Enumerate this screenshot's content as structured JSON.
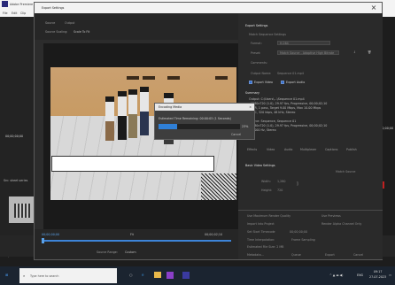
{
  "app": {
    "title": "Adobe Premiere",
    "menu": [
      "File",
      "Edit",
      "Clip"
    ],
    "left_timecode": "00;00;00;00",
    "right_timecode": "00;00;00;00",
    "source_label": "Src: sheet series",
    "bottom_labels": [
      "00;00;00;00",
      "Sequence"
    ]
  },
  "dialog": {
    "title": "Export Settings",
    "close_glyph": "×",
    "tabs": [
      "Source",
      "Output"
    ],
    "source_scaling_label": "Source Scaling:",
    "source_scaling_value": "Scale To Fit",
    "timeline_left_timecode": "00;00;00;00",
    "timeline_right_timecode": "00;00;02;10",
    "timeline_zoom": "Fit",
    "source_range_label": "Source Range:",
    "source_range_value": "Custom",
    "settings": {
      "section_title": "Export Settings",
      "match_sequence": "Match Sequence Settings",
      "format_label": "Format:",
      "format_value": "H.264",
      "preset_label": "Preset:",
      "preset_value": "Match Source - Adaptive High Bitrate",
      "comments_label": "Comments:",
      "output_name_label": "Output Name:",
      "output_name_value": "Sequence 01.mp4",
      "export_video": "Export Video",
      "export_audio": "Export Audio",
      "summary_title": "Summary",
      "summary_lines": [
        "Output: C:\\Users\\...\\Sequence 01.mp4",
        "1280x720 (1.0), 29.97 fps, Progressive, 00;00;02;10",
        "VBR, 1 pass, Target 9.00 Mbps, Max 10.00 Mbps",
        "AAC, 320 kbps, 48 kHz, Stereo",
        "Source: Sequence, Sequence 01",
        "1280x720 (1.0), 29.97 fps, Progressive, 00;00;02;10",
        "48000 Hz, Stereo"
      ],
      "sub_tabs": [
        "Effects",
        "Video",
        "Audio",
        "Multiplexer",
        "Captions",
        "Publish"
      ],
      "video_section": "Basic Video Settings",
      "match_source_button": "Match Source",
      "width_label": "Width:",
      "width_value": "1,280",
      "height_label": "Height:",
      "height_value": "720",
      "render_max_depth": "Use Maximum Render Quality",
      "use_previews": "Use Previews",
      "import_into_project": "Import Into Project",
      "set_start_timecode": "Set Start Timecode",
      "start_timecode_value": "00;00;00;00",
      "render_alpha": "Render Alpha Channel Only",
      "estimated_size": "Estimated File Size: 2 MB",
      "time_interp_label": "Time Interpolation:",
      "time_interp_value": "Frame Sampling",
      "buttons": [
        "Metadata...",
        "Queue",
        "Export",
        "Cancel"
      ]
    }
  },
  "progress": {
    "title": "Encoding Media",
    "close_glyph": "×",
    "status_text": "Estimated Time Remaining: 00:00:05 (1 Seconds)",
    "percent": "23%",
    "fraction": 0.23,
    "cancel_label": "Cancel"
  },
  "taskbar": {
    "search_placeholder": "Type here to search",
    "time": "09:17",
    "date": "27-07-2023",
    "lang": "ENG"
  },
  "colors": {
    "accent": "#2f7fd6",
    "progress": "#2f7fd6",
    "taskbar": "#1b2430",
    "pink": "#e04ab0"
  }
}
